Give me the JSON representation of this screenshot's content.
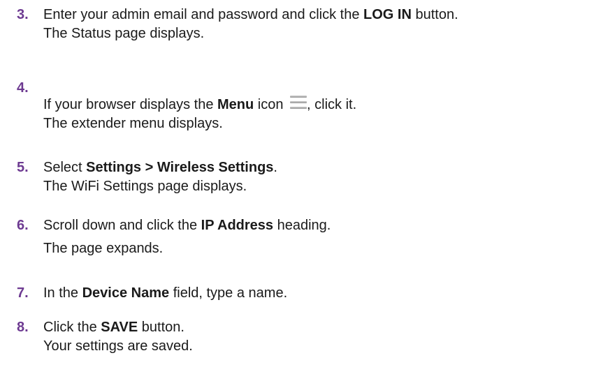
{
  "steps": [
    {
      "number": "3.",
      "line1": {
        "pre": "Enter your admin email and password and click the ",
        "bold": "LOG IN",
        "post": " button."
      },
      "line2": "The Status page displays."
    },
    {
      "number": "4.",
      "line1": {
        "pre": "If your browser displays the ",
        "bold": "Menu",
        "mid": " icon ",
        "post": ", click it."
      },
      "icon": "menu-icon",
      "line2": "The extender menu displays."
    },
    {
      "number": "5.",
      "line1": {
        "pre": "Select ",
        "bold1": "Settings",
        "sep": " > ",
        "bold2": "Wireless Settings",
        "post": "."
      },
      "line2": "The WiFi Settings page displays."
    },
    {
      "number": "6.",
      "line1": {
        "pre": "Scroll down and click the ",
        "bold": "IP Address",
        "post": " heading."
      },
      "line2": "The page expands."
    },
    {
      "number": "7.",
      "line1": {
        "pre": "In the ",
        "bold": "Device Name",
        "post": " field, type a name."
      }
    },
    {
      "number": "8.",
      "line1": {
        "pre": "Click the ",
        "bold": "SAVE",
        "post": " button."
      },
      "line2": "Your settings are saved."
    }
  ],
  "colors": {
    "step_number": "#6d3a91",
    "text": "#1a1a1a"
  }
}
